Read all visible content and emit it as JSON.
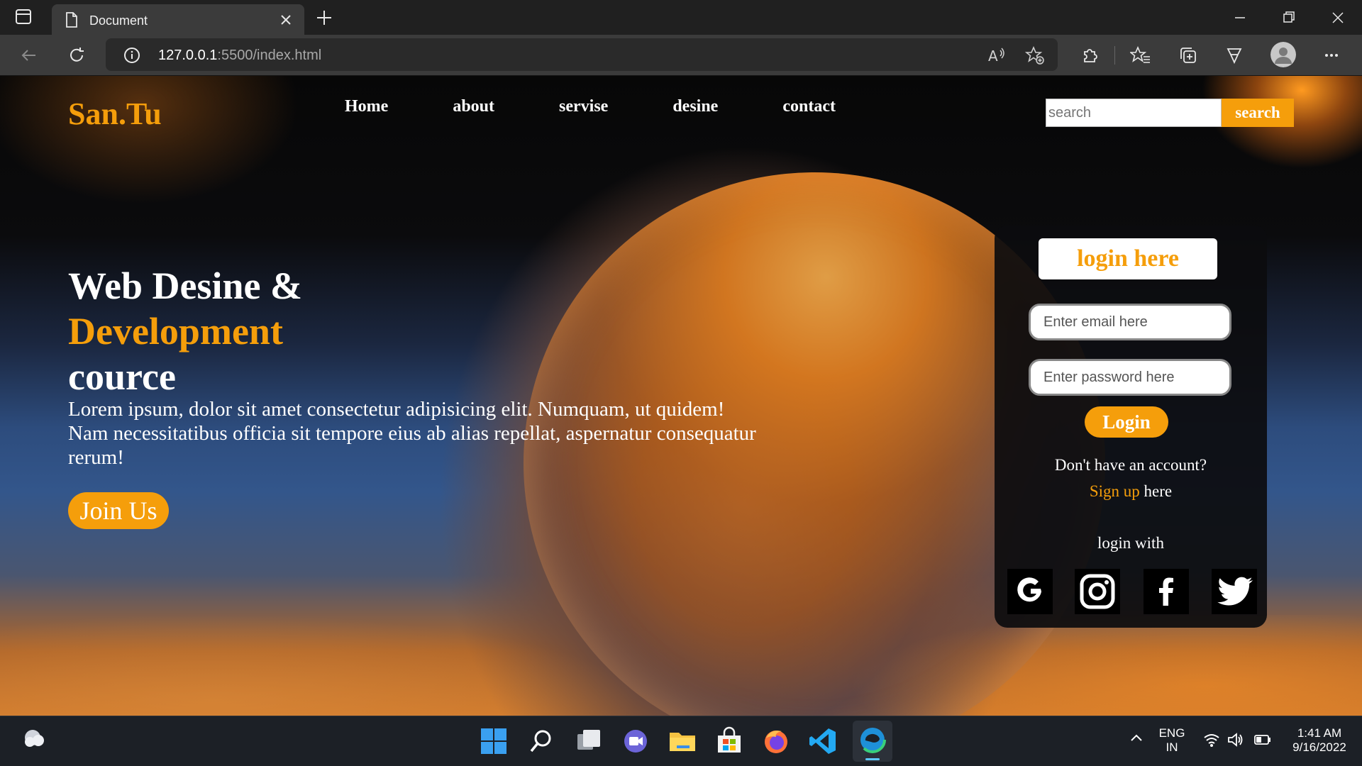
{
  "browser": {
    "tab_title": "Document",
    "url_host": "127.0.0.1",
    "url_path": ":5500/index.html"
  },
  "site": {
    "logo": "San.Tu",
    "nav": [
      "Home",
      "about",
      "servise",
      "desine",
      "contact"
    ],
    "search_placeholder": "search",
    "search_button": "search"
  },
  "hero": {
    "line1": "Web Desine &",
    "line2": "Development",
    "line3": "cource",
    "paragraph": "Lorem ipsum, dolor sit amet consectetur adipisicing elit. Numquam, ut quidem! Nam necessitatibus officia sit tempore eius ab alias repellat, aspernatur consequatur rerum!",
    "join_button": "Join Us"
  },
  "login": {
    "title": "login here",
    "email_placeholder": "Enter email here",
    "password_placeholder": "Enter password here",
    "login_button": "Login",
    "no_account": "Don't have an account?",
    "signup_link": "Sign up",
    "signup_suffix": " here",
    "login_with": "login with",
    "social": [
      "google-icon",
      "instagram-icon",
      "facebook-icon",
      "twitter-icon"
    ]
  },
  "taskbar": {
    "lang_top": "ENG",
    "lang_bottom": "IN",
    "time": "1:41 AM",
    "date": "9/16/2022"
  },
  "colors": {
    "accent": "#f59e0b",
    "card": "#0c0c0e"
  }
}
